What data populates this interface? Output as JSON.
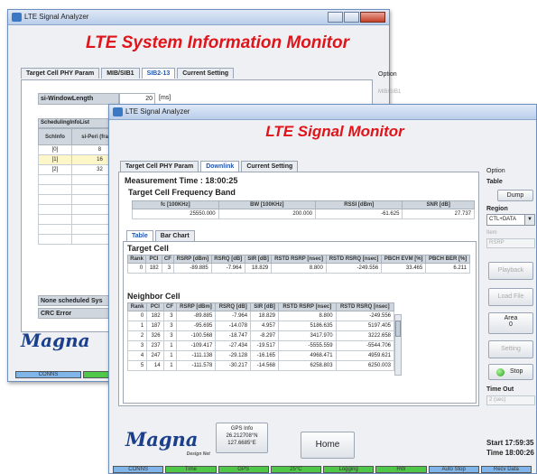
{
  "back": {
    "title": "LTE Signal Analyzer",
    "heading": "LTE System Information Monitor",
    "tabs": [
      "Target Cell PHY Param",
      "MIB/SIB1",
      "SIB2-13",
      "Current Setting"
    ],
    "si_label": "si-WindowLength",
    "si_value": "20",
    "si_unit": "[ms]",
    "sched_title": "SchedulingInfoList",
    "sched_headers": [
      "SchInfo",
      "si-Peri (frame)"
    ],
    "sched_rows": [
      [
        "[0]",
        "8"
      ],
      [
        "[1]",
        "16"
      ],
      [
        "[2]",
        "32"
      ]
    ],
    "none_label": "None scheduled Sys",
    "crc_label": "CRC Error",
    "option_label": "Option",
    "option_item": "MIB/SIB1",
    "status": [
      "CONNS",
      "Time"
    ],
    "logo": "Magna"
  },
  "front": {
    "title": "LTE Signal Analyzer",
    "heading": "LTE Signal Monitor",
    "tabs": [
      "Target Cell PHY Param",
      "Downlink",
      "Current Setting"
    ],
    "measurement_label": "Measurement Time :",
    "measurement_time": "18:00:25",
    "freq_title": "Target Cell Frequency Band",
    "freq_headers": [
      "fc [100KHz]",
      "BW [100KHz]",
      "RSSI [dBm]",
      "SNR [dB]"
    ],
    "freq_values": [
      "25550.000",
      "200.000",
      "-61.625",
      "27.737"
    ],
    "subtabs": [
      "Table",
      "Bar Chart"
    ],
    "target_title": "Target Cell",
    "cell_headers": [
      "Rank",
      "PCI",
      "CF",
      "RSRP [dBm]",
      "RSRQ [dB]",
      "SIR [dB]",
      "RSTD RSRP [nsec]",
      "RSTD RSRQ [nsec]",
      "PBCH EVM [%]",
      "PBCH BER [%]"
    ],
    "target_row": [
      "0",
      "182",
      "3",
      "-89.885",
      "-7.964",
      "18.829",
      "8.800",
      "-249.556",
      "33.465",
      "6.211"
    ],
    "neighbor_title": "Neighbor Cell",
    "neighbor_headers": [
      "Rank",
      "PCI",
      "CF",
      "RSRP [dBm]",
      "RSRQ [dB]",
      "SIR [dB]",
      "RSTD RSRP [nsec]",
      "RSTD RSRQ [nsec]"
    ],
    "neighbor_rows": [
      [
        "0",
        "182",
        "3",
        "-89.885",
        "-7.964",
        "18.829",
        "8.800",
        "-249.556"
      ],
      [
        "1",
        "187",
        "3",
        "-95.695",
        "-14.078",
        "4.957",
        "5186.635",
        "5197.405"
      ],
      [
        "2",
        "326",
        "3",
        "-100.568",
        "-18.747",
        "-8.297",
        "3417.970",
        "3222.658"
      ],
      [
        "3",
        "237",
        "1",
        "-109.417",
        "-27.434",
        "-19.517",
        "-5555.559",
        "-5544.706"
      ],
      [
        "4",
        "247",
        "1",
        "-111.138",
        "-29.128",
        "-16.165",
        "4968.471",
        "4959.621"
      ],
      [
        "5",
        "14",
        "1",
        "-111.578",
        "-30.217",
        "-14.568",
        "6258.803",
        "6250.003"
      ]
    ],
    "option": {
      "label": "Option",
      "table_label": "Table",
      "dump": "Dump",
      "region_label": "Region",
      "region_value": "CTL+DATA",
      "item_label": "Item",
      "item_value": "RSRP",
      "playback": "Playback",
      "load_file": "Load File",
      "area": "Area",
      "area_value": "0",
      "setting": "Setting",
      "stop": "Stop",
      "timeout_label": "Time Out",
      "timeout_value": "2 (sec)"
    },
    "gps": {
      "line1": "GPS Info",
      "line2": "26.212708°N",
      "line3": "127.6685°E"
    },
    "home": "Home",
    "start_label": "Start",
    "start_time": "17:59:35",
    "time_label": "Time",
    "time_value": "18:00:26",
    "logo": "Magna",
    "logo_sub": "Design Net",
    "status": [
      "CONNS",
      "Time",
      "GPS",
      "25°C",
      "Logging",
      "HW",
      "Auto Stop",
      "Recv Data"
    ],
    "status_colors": [
      "#7fb5e8",
      "#4fc84a",
      "#4fc84a",
      "#4fc84a",
      "#4fc84a",
      "#4fc84a",
      "#7fb5e8",
      "#7fb5e8"
    ]
  }
}
